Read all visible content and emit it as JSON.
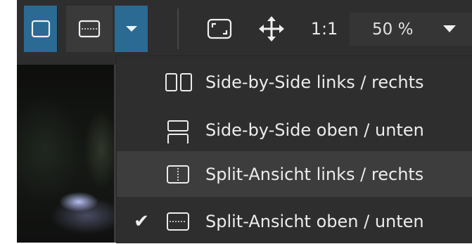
{
  "toolbar": {
    "view_mode_single": {
      "icon": "single-view-icon"
    },
    "view_mode_split": {
      "icon": "split-view-icon"
    },
    "view_mode_dropdown": {
      "icon": "caret-down-icon"
    },
    "fit_button": {
      "icon": "fit-to-window-icon"
    },
    "move_button": {
      "icon": "move-arrows-icon"
    },
    "actual_size_label": "1:1",
    "zoom": {
      "value": "50 %",
      "icon": "caret-down-icon"
    }
  },
  "view_menu": {
    "items": [
      {
        "label": "Side-by-Side links / rechts",
        "icon": "side-by-side-horizontal-icon",
        "checked": false,
        "highlighted": false
      },
      {
        "label": "Side-by-Side oben / unten",
        "icon": "side-by-side-vertical-icon",
        "checked": false,
        "highlighted": false
      },
      {
        "label": "Split-Ansicht links / rechts",
        "icon": "split-vertical-icon",
        "checked": false,
        "highlighted": true
      },
      {
        "label": "Split-Ansicht oben / unten",
        "icon": "split-horizontal-icon",
        "checked": true,
        "highlighted": false
      }
    ],
    "check_glyph": "✔"
  },
  "colors": {
    "toolbar_bg": "#2e2e2e",
    "active_blue": "#2a6a93",
    "menu_bg": "#2e2e2e",
    "menu_hover": "#3d3d3d",
    "text": "#ececec"
  }
}
